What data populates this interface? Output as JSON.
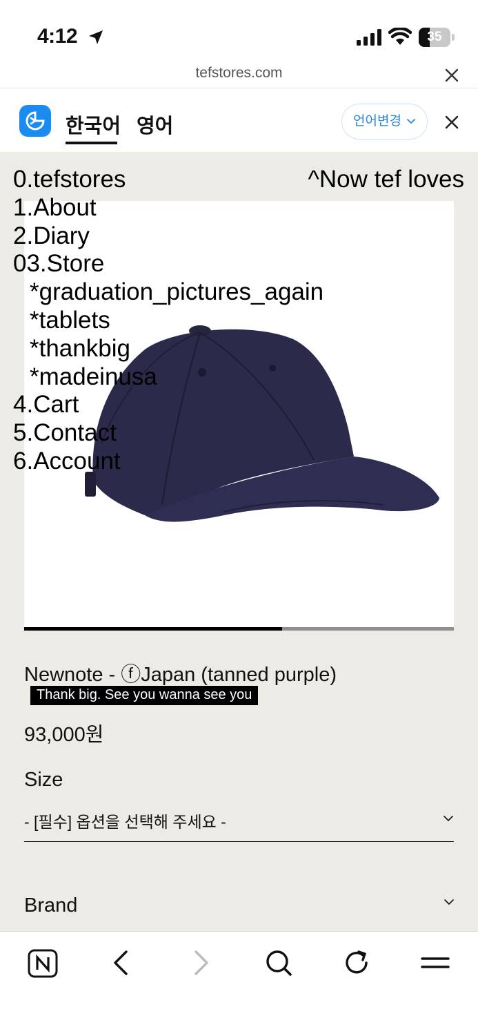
{
  "status_bar": {
    "time": "4:12",
    "battery_level": "35"
  },
  "url_bar": {
    "domain": "tefstores.com"
  },
  "translate_bar": {
    "source_language": "한국어",
    "target_language": "영어",
    "change_language_label": "언어변경",
    "accent_color": "#1a8cf0"
  },
  "site_nav": {
    "items": [
      "0.tefstores",
      "1.About",
      "2.Diary",
      "03.Store",
      "*graduation_pictures_again",
      "*tablets",
      "*thankbig",
      "*madeinusa",
      "4.Cart",
      "5.Contact",
      "6.Account"
    ],
    "marquee_text": "^Now tef loves"
  },
  "product": {
    "image_icon": "navy-baseball-cap-photo",
    "gallery_progress": 0.6,
    "title": "Newnote - ⓕJapan (tanned purple)",
    "tagline": "Thank big. See you wanna see you",
    "price": "93,000원",
    "size_label": "Size",
    "size_placeholder": "- [필수] 옵션을 선택해 주세요 -",
    "brand_label": "Brand"
  },
  "toolbar": {
    "icons": [
      "naver-home-icon",
      "back-icon",
      "forward-icon",
      "search-icon",
      "reload-icon",
      "menu-icon"
    ]
  },
  "colors": {
    "page_background": "#ecebe5",
    "cap_color": "#2b2a4a"
  }
}
